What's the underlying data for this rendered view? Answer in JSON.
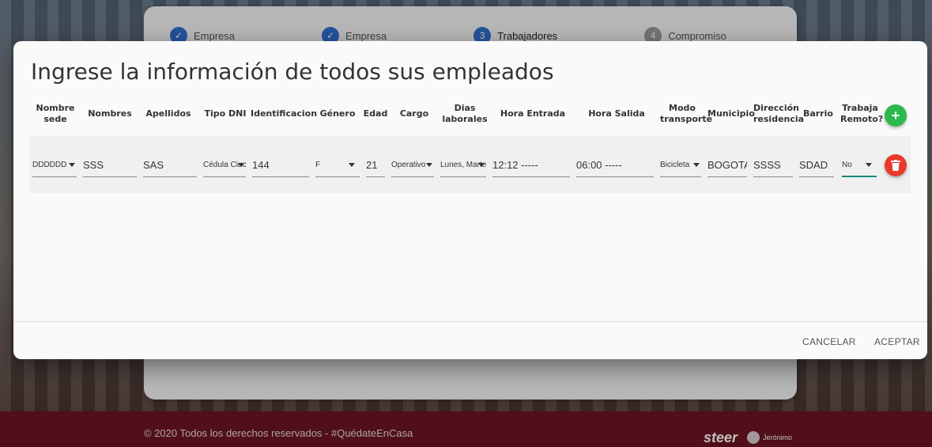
{
  "stepper": {
    "steps": [
      {
        "label": "Empresa",
        "state": "done"
      },
      {
        "label": "Empresa",
        "state": "done"
      },
      {
        "label": "Trabajadores",
        "number": "3",
        "state": "active"
      },
      {
        "label": "Compromiso",
        "number": "4",
        "state": "pending"
      }
    ]
  },
  "modal": {
    "title": "Ingrese la información de todos sus empleados",
    "headers": {
      "nombre_sede": "Nombre sede",
      "nombres": "Nombres",
      "apellidos": "Apellidos",
      "tipo_dni": "Tipo DNI",
      "identificacion": "Identificacion",
      "genero": "Género",
      "edad": "Edad",
      "cargo": "Cargo",
      "dias_laborales": "Dias laborales",
      "hora_entrada": "Hora Entrada",
      "hora_salida": "Hora Salida",
      "modo_transporte": "Modo transporte",
      "municipio": "Municipio",
      "direccion": "Dirección residencia",
      "barrio": "Barrio",
      "trabaja_remoto": "Trabaja Remoto?"
    },
    "row": {
      "nombre_sede": "DDDDDD",
      "nombres": "SSS",
      "apellidos": "SAS",
      "tipo_dni": "Cédula Ciuc",
      "identificacion": "144",
      "genero": "F",
      "edad": "21",
      "cargo": "Operativo",
      "dias_laborales": "Lunes, Marte",
      "hora_entrada": "12:12 -----",
      "hora_salida": "06:00 -----",
      "modo_transporte": "Bicicleta",
      "municipio": "BOGOTA",
      "direccion": "SSSS",
      "barrio": "SDAD",
      "trabaja_remoto": "No"
    },
    "actions": {
      "cancel": "CANCELAR",
      "accept": "ACEPTAR"
    }
  },
  "footer": {
    "text": "© 2020 Todos los derechos reservados - #QuédateEnCasa",
    "logo": "steer",
    "logo2": "Jerónimo"
  },
  "colors": {
    "add": "#2db84c",
    "delete": "#e8392c",
    "footer": "#6b1522",
    "step": "#2f6fd1"
  }
}
